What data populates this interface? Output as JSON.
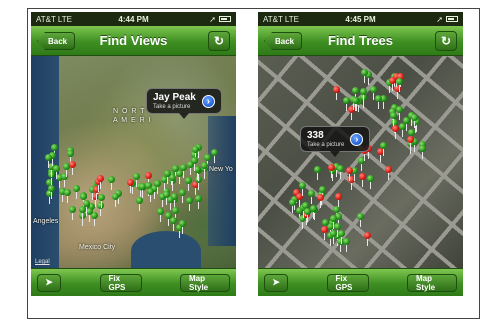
{
  "screens": [
    {
      "status": {
        "carrier": "AT&T  LTE",
        "time": "4:44 PM"
      },
      "nav": {
        "back": "Back",
        "title": "Find Views",
        "refresh_glyph": "↻"
      },
      "map_labels": {
        "north": "N O R T",
        "america": "A M E R I",
        "angeles": "Angeles",
        "new_york": "New Yo",
        "mexico": "Mexico City"
      },
      "callout": {
        "title": "Jay Peak",
        "subtitle": "Take a picture",
        "disclosure": "›"
      },
      "legal": "Legal",
      "toolbar": {
        "locate_glyph": "➤",
        "fix_gps": "Fix GPS",
        "map_style": "Map Style"
      }
    },
    {
      "status": {
        "carrier": "AT&T  LTE",
        "time": "4:45 PM"
      },
      "nav": {
        "back": "Back",
        "title": "Find Trees",
        "refresh_glyph": "↻"
      },
      "callout": {
        "title": "338",
        "subtitle": "Take a picture",
        "disclosure": "›"
      },
      "toolbar": {
        "locate_glyph": "➤",
        "fix_gps": "Fix GPS",
        "map_style": "Map Style"
      }
    }
  ],
  "colors": {
    "bar_green": "#3d8f22",
    "pin_green": "#1c8a14",
    "pin_red": "#d3160f",
    "disclosure_blue": "#1e5fd6"
  }
}
